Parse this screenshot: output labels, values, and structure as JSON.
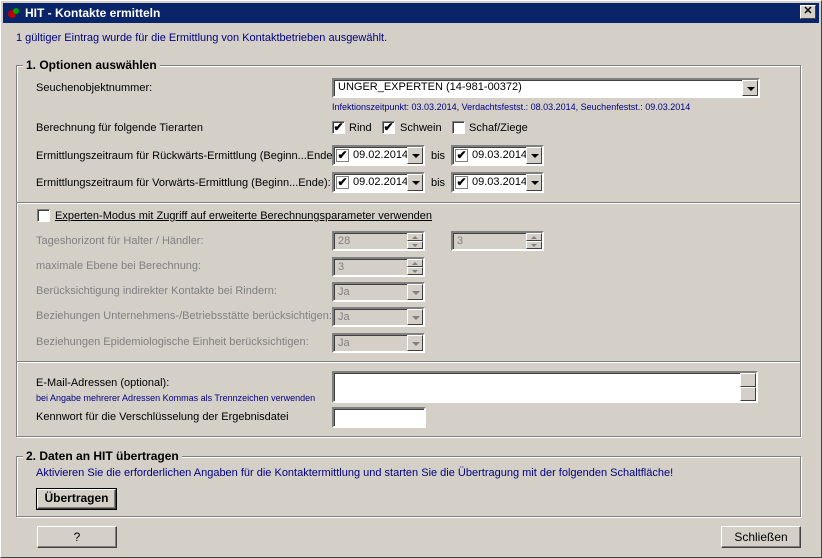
{
  "window": {
    "title": "HIT - Kontakte ermitteln",
    "close_glyph": "✕"
  },
  "info_text": "1 gültiger Eintrag wurde für die Ermittlung von Kontaktbetrieben ausgewählt.",
  "options": {
    "legend": "1. Optionen auswählen",
    "seuchenobjekt_label": "Seuchenobjektnummer:",
    "seuchenobjekt_value": "UNGER_EXPERTEN (14-981-00372)",
    "seuchen_info": "Infektionszeitpunkt: 03.03.2014, Verdachtsfestst.: 08.03.2014, Seuchenfestst.: 09.03.2014",
    "tierarten_label": "Berechnung für folgende Tierarten",
    "tierarten": [
      {
        "label": "Rind",
        "checked": true
      },
      {
        "label": "Schwein",
        "checked": true
      },
      {
        "label": "Schaf/Ziege",
        "checked": false
      }
    ],
    "rueck_label": "Ermittlungszeitraum für Rückwärts-Ermittlung (Beginn...Ende):",
    "rueck_from": "09.02.2014",
    "rueck_to": "09.03.2014",
    "vor_label": "Ermittlungszeitraum für Vorwärts-Ermittlung (Beginn...Ende):",
    "vor_from": "09.02.2014",
    "vor_to": "09.03.2014",
    "bis": "bis",
    "expert_mode_label": "Experten-Modus mit Zugriff auf erweiterte Berechnungsparameter verwenden",
    "tageshorizont_label": "Tageshorizont für Halter / Händler:",
    "tageshorizont_halter": "28",
    "tageshorizont_haendler": "3",
    "ebene_label": "maximale Ebene bei Berechnung:",
    "ebene_value": "3",
    "indirekt_label": "Berücksichtigung indirekter Kontakte bei Rindern:",
    "indirekt_value": "Ja",
    "unternehmen_label": "Beziehungen Unternehmens-/Betriebsstätte berücksichtigen:",
    "unternehmen_value": "Ja",
    "epi_label": "Beziehungen Epidemiologische Einheit berücksichtigen:",
    "epi_value": "Ja",
    "email_label": "E-Mail-Adressen (optional):",
    "email_hint": "bei Angabe mehrerer Adressen Kommas als Trennzeichen verwenden",
    "email_value": "",
    "kennwort_label": "Kennwort für die Verschlüsselung der Ergebnisdatei",
    "kennwort_value": ""
  },
  "transfer": {
    "legend": "2. Daten an HIT übertragen",
    "text": "Aktivieren Sie die erforderlichen Angaben für die Kontaktermittlung und starten Sie die Übertragung mit der folgenden Schaltfläche!",
    "button": "Übertragen"
  },
  "footer": {
    "help_button": "?",
    "close_button": "Schließen"
  },
  "check_glyph": "✔"
}
